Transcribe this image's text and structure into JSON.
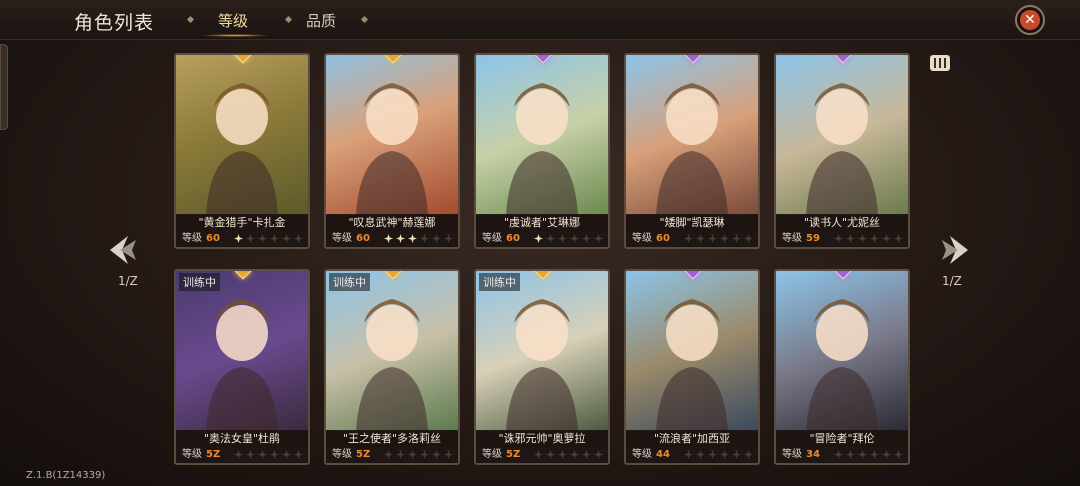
{
  "header": {
    "title": "角色列表",
    "tabs": [
      {
        "label": "等级",
        "active": true
      },
      {
        "label": "品质",
        "active": false
      }
    ]
  },
  "pagination": {
    "left": "1/Z",
    "right": "1/Z"
  },
  "version": "Z.1.B(1Z14339)",
  "level_label": "等级",
  "training_label": "训练中",
  "colors": {
    "accent": "#f08a2a",
    "gem_gold": "#e8a62c",
    "gem_purple": "#a060e0"
  },
  "cards": [
    {
      "name": "\"黄金猎手\"卡扎金",
      "level": "60",
      "stars": 1,
      "gem": "gold",
      "training": false
    },
    {
      "name": "\"叹息武神\"赫莲娜",
      "level": "60",
      "stars": 3,
      "gem": "gold",
      "training": false
    },
    {
      "name": "\"虔诚者\"艾琳娜",
      "level": "60",
      "stars": 1,
      "gem": "purple",
      "training": false
    },
    {
      "name": "\"矮脚\"凯瑟琳",
      "level": "60",
      "stars": 0,
      "gem": "purple",
      "training": false
    },
    {
      "name": "\"读书人\"尤妮丝",
      "level": "59",
      "stars": 0,
      "gem": "purple",
      "training": false
    },
    {
      "name": "\"奥法女皇\"杜鹃",
      "level": "5Z",
      "stars": 0,
      "gem": "gold",
      "training": true
    },
    {
      "name": "\"王之使者\"多洛莉丝",
      "level": "5Z",
      "stars": 0,
      "gem": "gold",
      "training": true
    },
    {
      "name": "\"诛邪元帅\"奥萝拉",
      "level": "5Z",
      "stars": 0,
      "gem": "gold",
      "training": true
    },
    {
      "name": "\"流浪者\"加西亚",
      "level": "44",
      "stars": 0,
      "gem": "purple",
      "training": false
    },
    {
      "name": "\"冒险者\"拜伦",
      "level": "34",
      "stars": 0,
      "gem": "purple",
      "training": false
    }
  ]
}
